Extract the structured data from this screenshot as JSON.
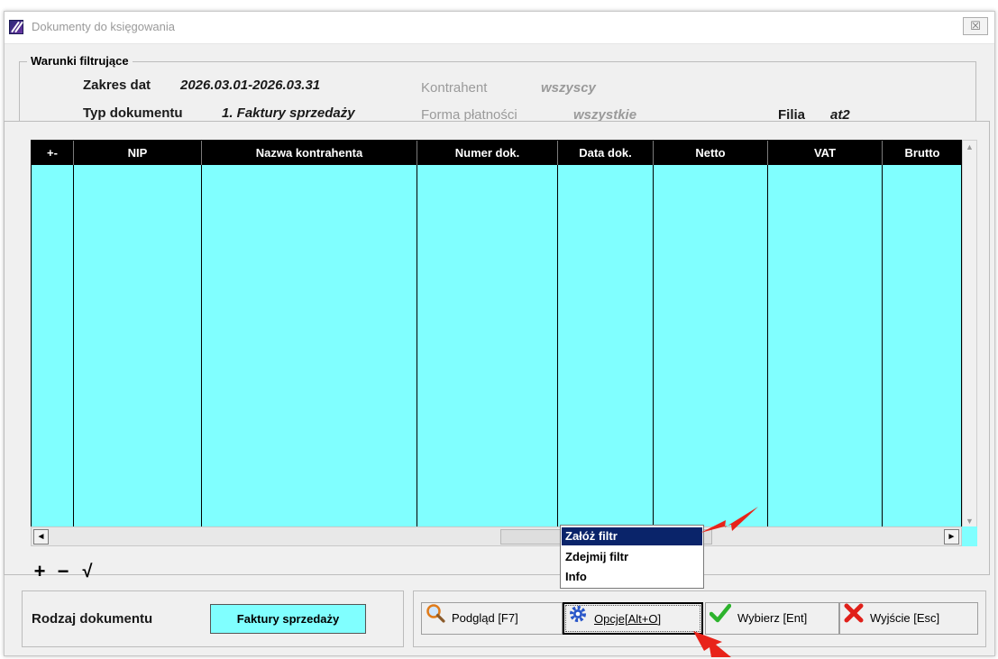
{
  "window": {
    "title": "Dokumenty do księgowania",
    "close_symbol": "☒"
  },
  "filters": {
    "legend": "Warunki filtrujące",
    "date_range_label": "Zakres dat",
    "date_range_value": "2026.03.01-2026.03.31",
    "doc_type_label": "Typ dokumentu",
    "doc_type_value": "1. Faktury sprzedaży",
    "contractor_label": "Kontrahent",
    "contractor_value": "wszyscy",
    "payment_label": "Forma płatności",
    "payment_value": "wszystkie",
    "branch_label": "Filia",
    "branch_value": "at2"
  },
  "grid": {
    "columns": [
      "+-",
      "NIP",
      "Nazwa kontrahenta",
      "Numer dok.",
      "Data dok.",
      "Netto",
      "VAT",
      "Brutto"
    ],
    "rows": []
  },
  "row_buttons": {
    "add": "+",
    "remove": "−",
    "confirm": "√"
  },
  "context_menu": {
    "items": [
      "Załóż filtr",
      "Zdejmij filtr",
      "Info"
    ],
    "selected": "Załóż filtr"
  },
  "document_kind": {
    "label": "Rodzaj dokumentu",
    "value": "Faktury sprzedaży"
  },
  "actions": {
    "preview": "Podgląd  [F7]",
    "options": "Opcje[Alt+O]",
    "select": "Wybierz  [Ent]",
    "exit": "Wyjście  [Esc]"
  },
  "colors": {
    "grid_bg": "#80ffff",
    "header_bg": "#000000",
    "menu_highlight": "#0a246a",
    "arrow": "#e8231a"
  },
  "icons": {
    "preview": "magnifier-icon",
    "options": "gear-icon",
    "select": "checkmark-icon",
    "exit": "red-x-icon"
  }
}
